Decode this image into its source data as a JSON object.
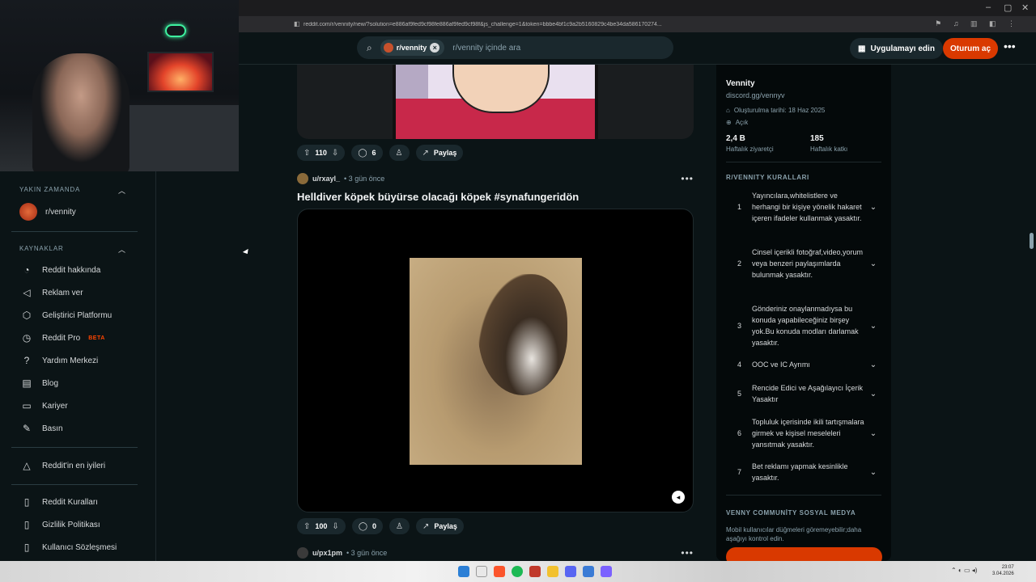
{
  "browser": {
    "url": "reddit.com/r/vennity/new/?solution=e886af9fed9cf98fe886af9fed9cf98f&js_challenge=1&token=bbbe4bf1c9a2b5160829c4be34da586170274...",
    "window_controls": [
      "–",
      "▢",
      "✕"
    ]
  },
  "header": {
    "search_chip": "r/vennity",
    "search_placeholder": "r/vennity içinde ara",
    "app_button": "Uygulamayı edin",
    "login_button": "Oturum aç",
    "more": "•••"
  },
  "left_nav": {
    "recent_title": "YAKIN ZAMANDA",
    "recent_items": [
      {
        "label": "r/vennity",
        "icon": "community-avatar"
      }
    ],
    "resources_title": "KAYNAKLAR",
    "resources": [
      {
        "label": "Reddit hakkında",
        "icon": "reddit-icon",
        "glyph": "◔"
      },
      {
        "label": "Reklam ver",
        "icon": "megaphone-icon",
        "glyph": "◁"
      },
      {
        "label": "Geliştirici Platformu",
        "icon": "developer-icon",
        "glyph": "⬡"
      },
      {
        "label": "Reddit Pro",
        "icon": "pro-icon",
        "glyph": "◷",
        "badge": "BETA"
      },
      {
        "label": "Yardım Merkezi",
        "icon": "help-icon",
        "glyph": "?"
      },
      {
        "label": "Blog",
        "icon": "book-icon",
        "glyph": "▤"
      },
      {
        "label": "Kariyer",
        "icon": "briefcase-icon",
        "glyph": "▭"
      },
      {
        "label": "Basın",
        "icon": "microphone-icon",
        "glyph": "✎"
      }
    ],
    "best_of": {
      "label": "Reddit'in en iyileri",
      "icon": "best-of-icon",
      "glyph": "△"
    },
    "legal": [
      {
        "label": "Reddit Kuralları",
        "icon": "rules-icon",
        "glyph": "▯"
      },
      {
        "label": "Gizlilik Politikası",
        "icon": "privacy-icon",
        "glyph": "▯"
      },
      {
        "label": "Kullanıcı Sözleşmesi",
        "icon": "agreement-icon",
        "glyph": "▯"
      }
    ]
  },
  "posts": [
    {
      "votes": "110",
      "comments": "6",
      "share": "Paylaş"
    },
    {
      "user": "u/rxayl_",
      "time": "• 3 gün önce",
      "title": "Helldiver köpek büyürse olacağı köpek #synafungeridön",
      "votes": "100",
      "comments": "0",
      "share": "Paylaş"
    },
    {
      "user": "u/px1pm",
      "time": "• 3 gün önce"
    }
  ],
  "sidebar": {
    "name": "Vennity",
    "link": "discord.gg/vennyv",
    "created": "Oluşturulma tarihi: 18 Haz 2025",
    "visibility": "Açık",
    "stats": [
      {
        "value": "2,4 B",
        "label": "Haftalık ziyaretçi"
      },
      {
        "value": "185",
        "label": "Haftalık katkı"
      }
    ],
    "rules_title": "R/VENNITY KURALLARI",
    "rules": [
      {
        "num": "1",
        "text": "Yayıncılara,whitelistlere ve herhangi bir kişiye yönelik hakaret içeren ifadeler kullanmak yasaktır."
      },
      {
        "num": "2",
        "text": "Cinsel içerikli fotoğraf,video,yorum veya benzeri paylaşımlarda bulunmak yasaktır."
      },
      {
        "num": "3",
        "text": "Gönderiniz onaylanmadıysa bu konuda yapabileceğiniz birşey yok.Bu konuda modları darlamak yasaktır."
      },
      {
        "num": "4",
        "text": "OOC ve IC Ayrımı"
      },
      {
        "num": "5",
        "text": "Rencide Edici ve Aşağılayıcı İçerik Yasaktır"
      },
      {
        "num": "6",
        "text": "Topluluk içerisinde ikili tartışmalara girmek ve kişisel meseleleri yansıtmak yasaktır."
      },
      {
        "num": "7",
        "text": "Bet reklamı yapmak kesinlikle yasaktır."
      }
    ],
    "social_title": "VENNY COMMUNİTY SOSYAL MEDYA",
    "social_desc": "Mobil kullanıcılar düğmeleri göremeyebilir;daha aşağıyı kontrol edin."
  },
  "taskbar": {
    "time": "23:07",
    "date": "3.04.2026"
  },
  "colors": {
    "accent": "#d93900",
    "bg": "#0b1416",
    "surface": "#1a282d"
  }
}
